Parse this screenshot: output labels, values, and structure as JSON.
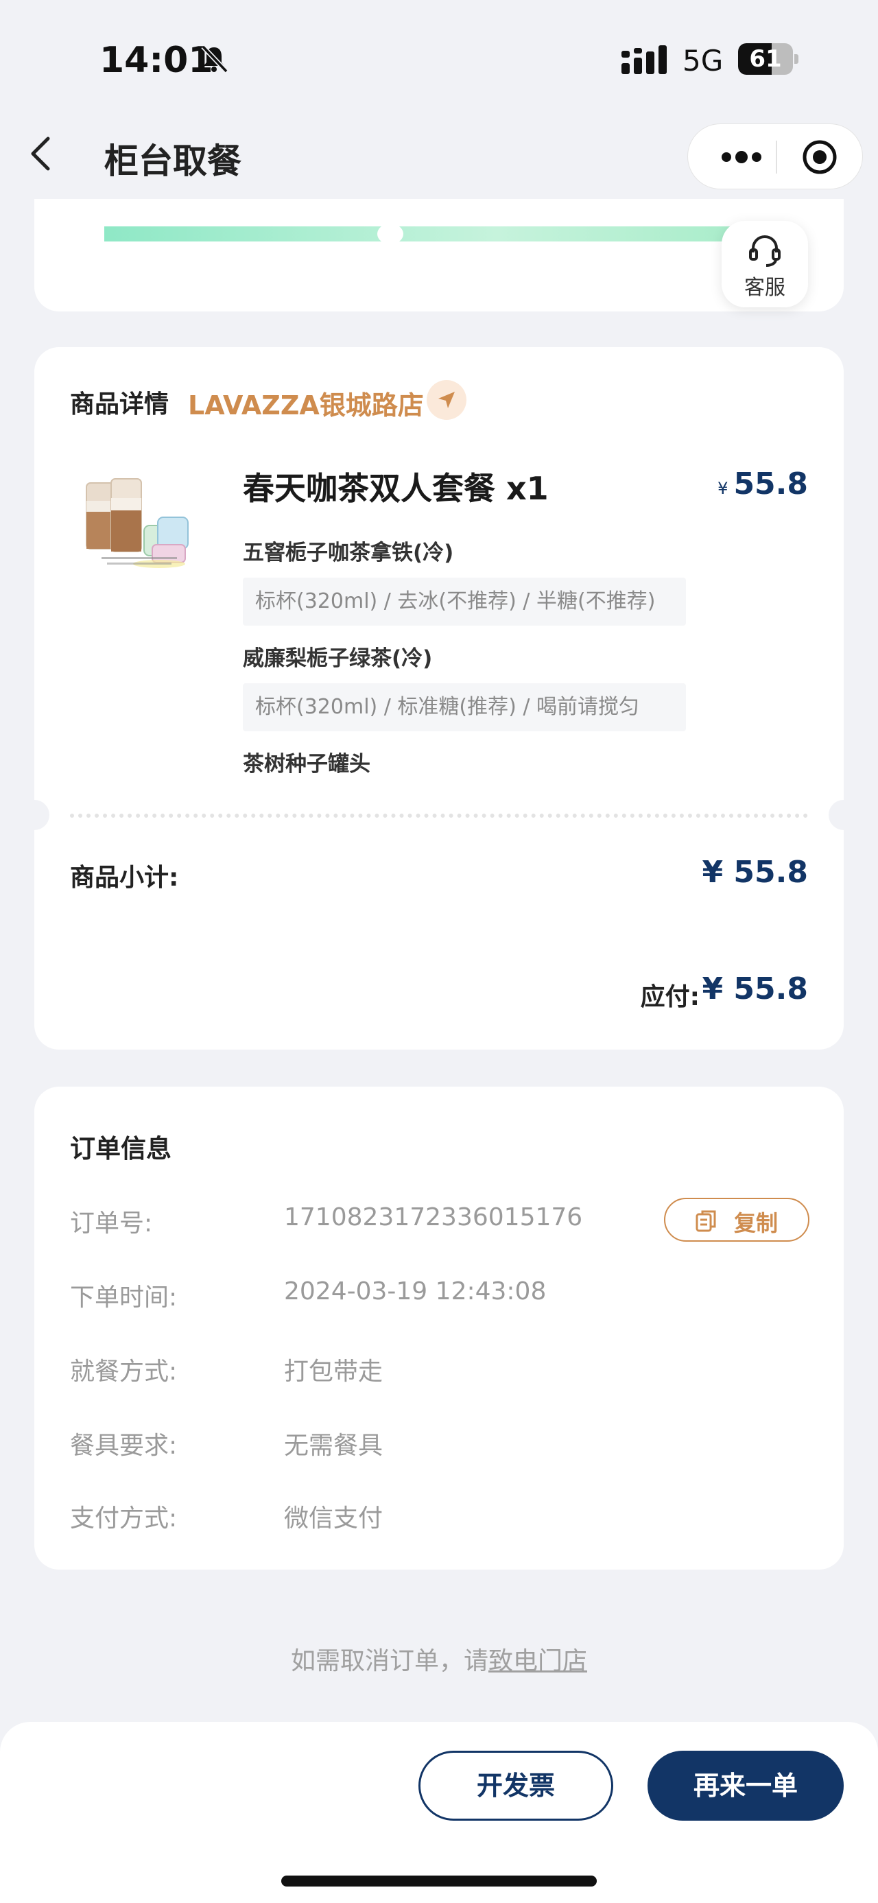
{
  "status_bar": {
    "time": "14:01",
    "network": "5G",
    "battery": "61",
    "battery_level": 0.61
  },
  "nav": {
    "title": "柜台取餐"
  },
  "progress": {
    "support_label": "客服"
  },
  "product": {
    "detail_label": "商品详情",
    "store_name": "LAVAZZA银城路店",
    "name": "春天咖茶双人套餐 x1",
    "currency": "¥",
    "price": "55.8",
    "items": [
      {
        "name": "五窨栀子咖茶拿铁(冷)",
        "spec": "标杯(320ml) / 去冰(不推荐) / 半糖(不推荐)"
      },
      {
        "name": "威廉梨栀子绿茶(冷)",
        "spec": "标杯(320ml) / 标准糖(推荐) / 喝前请搅匀"
      },
      {
        "name": "茶树种子罐头",
        "spec": ""
      }
    ],
    "subtotal_label": "商品小计:",
    "subtotal_value": "¥ 55.8",
    "payable_label": "应付:",
    "payable_value": "¥ 55.8"
  },
  "order": {
    "title": "订单信息",
    "copy_label": "复制",
    "rows": [
      {
        "label": "订单号:",
        "value": "1710823172336015176"
      },
      {
        "label": "下单时间:",
        "value": "2024-03-19 12:43:08"
      },
      {
        "label": "就餐方式:",
        "value": "打包带走"
      },
      {
        "label": "餐具要求:",
        "value": "无需餐具"
      },
      {
        "label": "支付方式:",
        "value": "微信支付"
      }
    ]
  },
  "footer": {
    "cancel_note": "如需取消订单，请",
    "cancel_link": "致电门店",
    "invoice_label": "开发票",
    "reorder_label": "再来一单"
  },
  "colors": {
    "brand_navy": "#123566",
    "store_accent": "#cf8c4e",
    "background": "#f1f2f6"
  }
}
